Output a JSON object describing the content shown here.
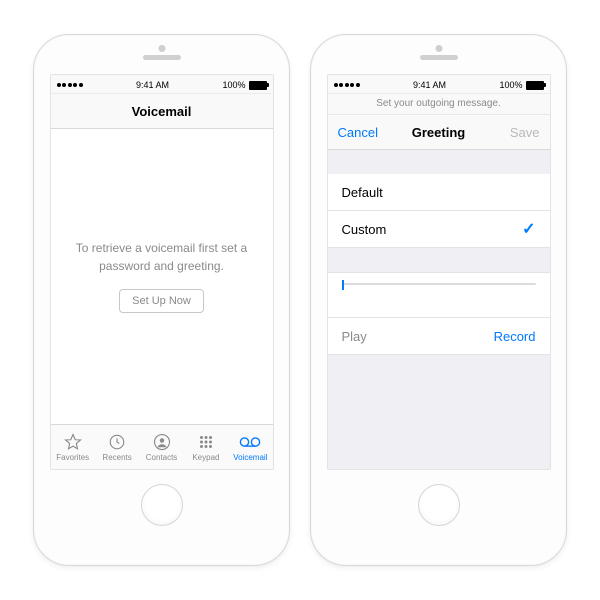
{
  "status": {
    "time": "9:41 AM",
    "battery_pct": "100%"
  },
  "phone1": {
    "nav_title": "Voicemail",
    "empty_msg": "To retrieve a voicemail first set a password and greeting.",
    "setup_btn": "Set Up Now",
    "tabs": [
      {
        "label": "Favorites"
      },
      {
        "label": "Recents"
      },
      {
        "label": "Contacts"
      },
      {
        "label": "Keypad"
      },
      {
        "label": "Voicemail"
      }
    ],
    "active_tab_index": 4
  },
  "phone2": {
    "help_text": "Set your outgoing message.",
    "nav_left": "Cancel",
    "nav_title": "Greeting",
    "nav_right": "Save",
    "nav_right_enabled": false,
    "options": [
      {
        "label": "Default",
        "selected": false
      },
      {
        "label": "Custom",
        "selected": true
      }
    ],
    "play_label": "Play",
    "record_label": "Record"
  }
}
